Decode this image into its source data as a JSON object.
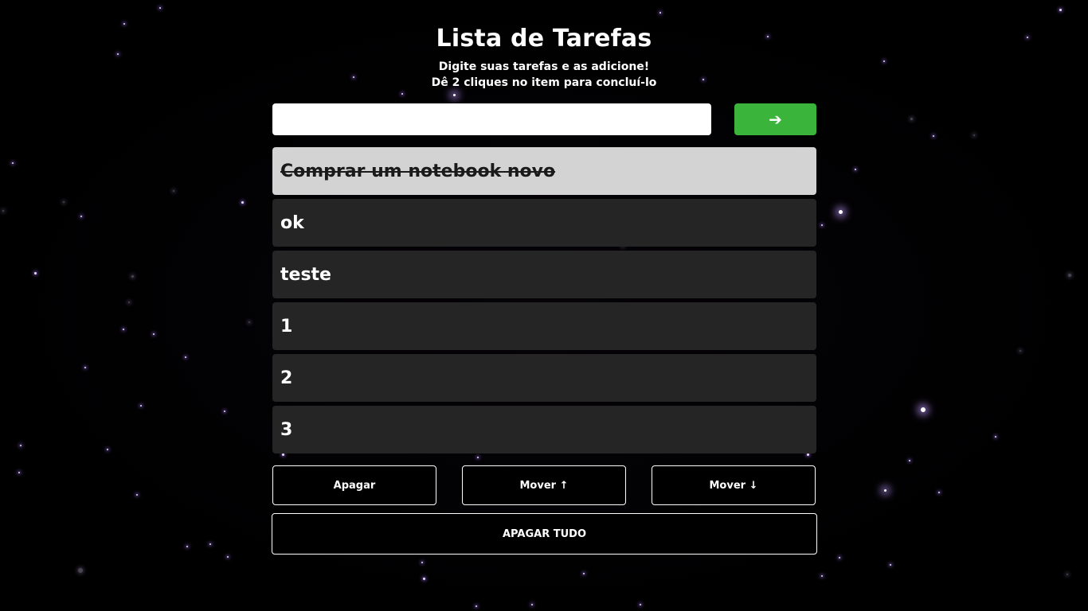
{
  "header": {
    "title": "Lista de Tarefas",
    "subtitle_line1": "Digite suas tarefas e as adicione!",
    "subtitle_line2": "Dê 2 cliques no item para concluí-lo"
  },
  "input": {
    "value": "",
    "placeholder": ""
  },
  "add_button": {
    "label": "➔",
    "icon": "arrow-right-icon",
    "color": "#3bb43c"
  },
  "tasks": [
    {
      "text": "Comprar um notebook novo",
      "completed": true
    },
    {
      "text": "ok",
      "completed": false
    },
    {
      "text": "teste",
      "completed": false
    },
    {
      "text": "1",
      "completed": false
    },
    {
      "text": "2",
      "completed": false
    },
    {
      "text": "3",
      "completed": false
    }
  ],
  "actions": {
    "delete_label": "Apagar",
    "move_up_label": "Mover ↑",
    "move_down_label": "Mover ↓",
    "clear_all_label": "APAGAR TUDO"
  },
  "colors": {
    "background": "#000000",
    "task_item": "#252525",
    "task_done": "#d3d3d3",
    "accent": "#3bb43c"
  }
}
